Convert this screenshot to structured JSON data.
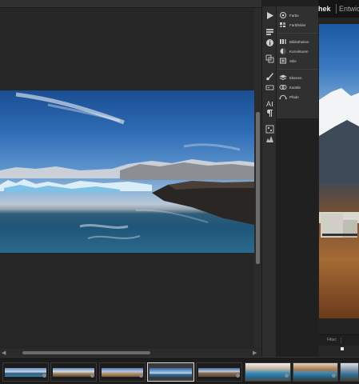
{
  "panel": {
    "items": [
      {
        "label": "Farbe",
        "icon": "color-wheel-icon"
      },
      {
        "label": "Farbfelder",
        "icon": "swatches-icon"
      },
      {
        "label": "Bibliotheken",
        "icon": "libraries-icon"
      },
      {
        "label": "Korrekturen",
        "icon": "adjustments-icon"
      },
      {
        "label": "Stile",
        "icon": "styles-icon"
      },
      {
        "label": "Ebenen",
        "icon": "layers-icon"
      },
      {
        "label": "Kanäle",
        "icon": "channels-icon"
      },
      {
        "label": "Pfade",
        "icon": "paths-icon"
      }
    ]
  },
  "toolstrip": {
    "icons": [
      "play-icon",
      "history-icon",
      "info-icon",
      "clone-source-icon",
      "brush-icon",
      "tool-presets-icon",
      "character-icon",
      "paragraph-icon",
      "properties-icon",
      "histogram-icon"
    ]
  },
  "right_app": {
    "menu_active": "hek",
    "menu_next": "Entwic",
    "filter_label": "Filter:"
  },
  "colors": {
    "accent_selected_border": "#d8d8d8",
    "panel_bg": "#303030",
    "workspace_bg": "#262626"
  }
}
